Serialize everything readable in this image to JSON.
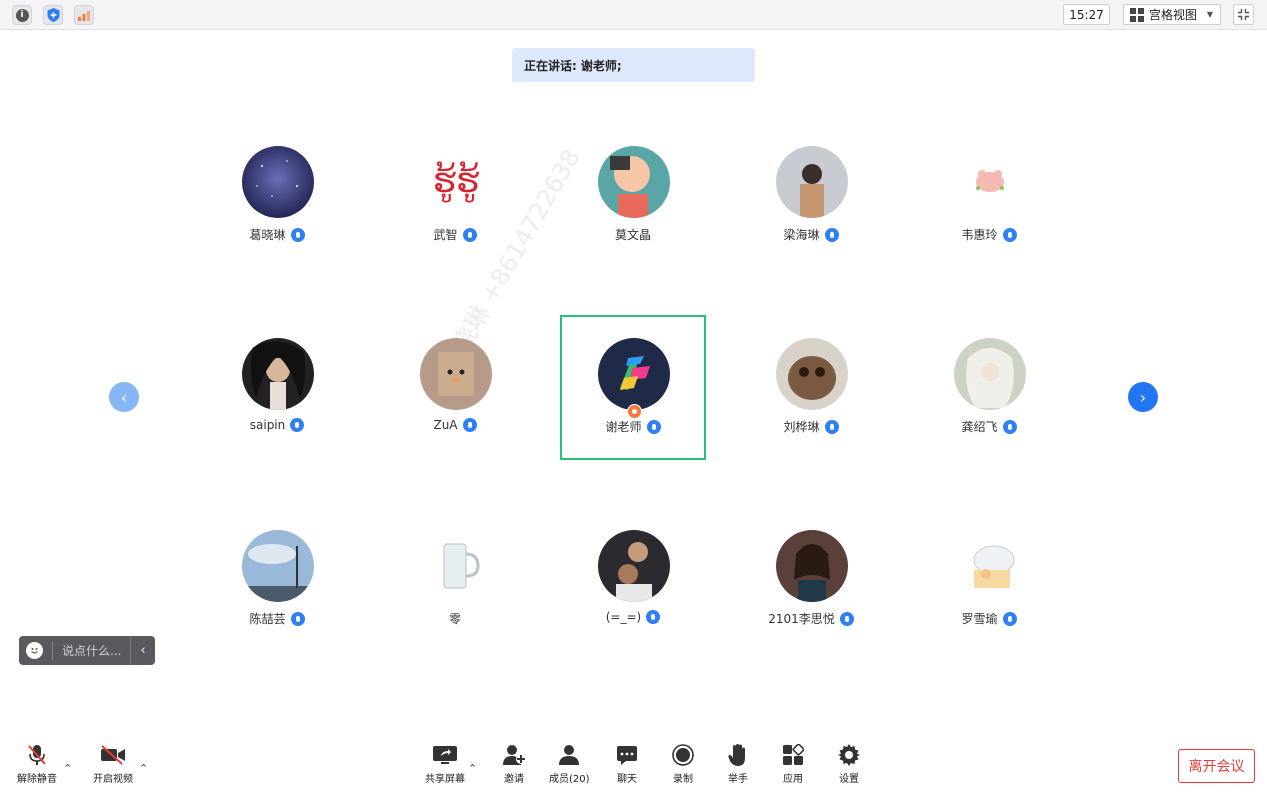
{
  "topbar": {
    "time": "15:27",
    "view_mode": "宫格视图",
    "icons": [
      "info-icon",
      "shield-icon",
      "signal-icon",
      "exit-fullscreen-icon"
    ]
  },
  "speaking": {
    "label": "正在讲话:",
    "name": "谢老师;"
  },
  "watermark": "葛晓琳 +8614722638",
  "participants": [
    {
      "name": "葛晓琳",
      "mic": true
    },
    {
      "name": "武智",
      "mic": true
    },
    {
      "name": "莫文晶",
      "mic": false
    },
    {
      "name": "梁海琳",
      "mic": true
    },
    {
      "name": "韦惠玲",
      "mic": true
    },
    {
      "name": "saipin",
      "mic": true
    },
    {
      "name": "ZuA",
      "mic": true
    },
    {
      "name": "谢老师",
      "mic": true,
      "host": true,
      "active_speaker": true
    },
    {
      "name": "刘桦琳",
      "mic": true
    },
    {
      "name": "龚绍飞",
      "mic": true
    },
    {
      "name": "陈喆芸",
      "mic": true
    },
    {
      "name": "零",
      "mic": false
    },
    {
      "name": "(=_=)",
      "mic": true
    },
    {
      "name": "2101李思悦",
      "mic": true
    },
    {
      "name": "罗雪瑜",
      "mic": true
    }
  ],
  "chat": {
    "placeholder": "说点什么..."
  },
  "toolbar": {
    "unmute": "解除静音",
    "start_video": "开启视频",
    "share_screen": "共享屏幕",
    "invite": "邀请",
    "members": "成员(20)",
    "chat": "聊天",
    "record": "录制",
    "raise_hand": "举手",
    "apps": "应用",
    "settings": "设置",
    "leave": "离开会议"
  },
  "colors": {
    "accent": "#2f7ff7",
    "active_border": "#25c27a",
    "leave": "#e23c3c",
    "banner": "#dce9fb"
  }
}
